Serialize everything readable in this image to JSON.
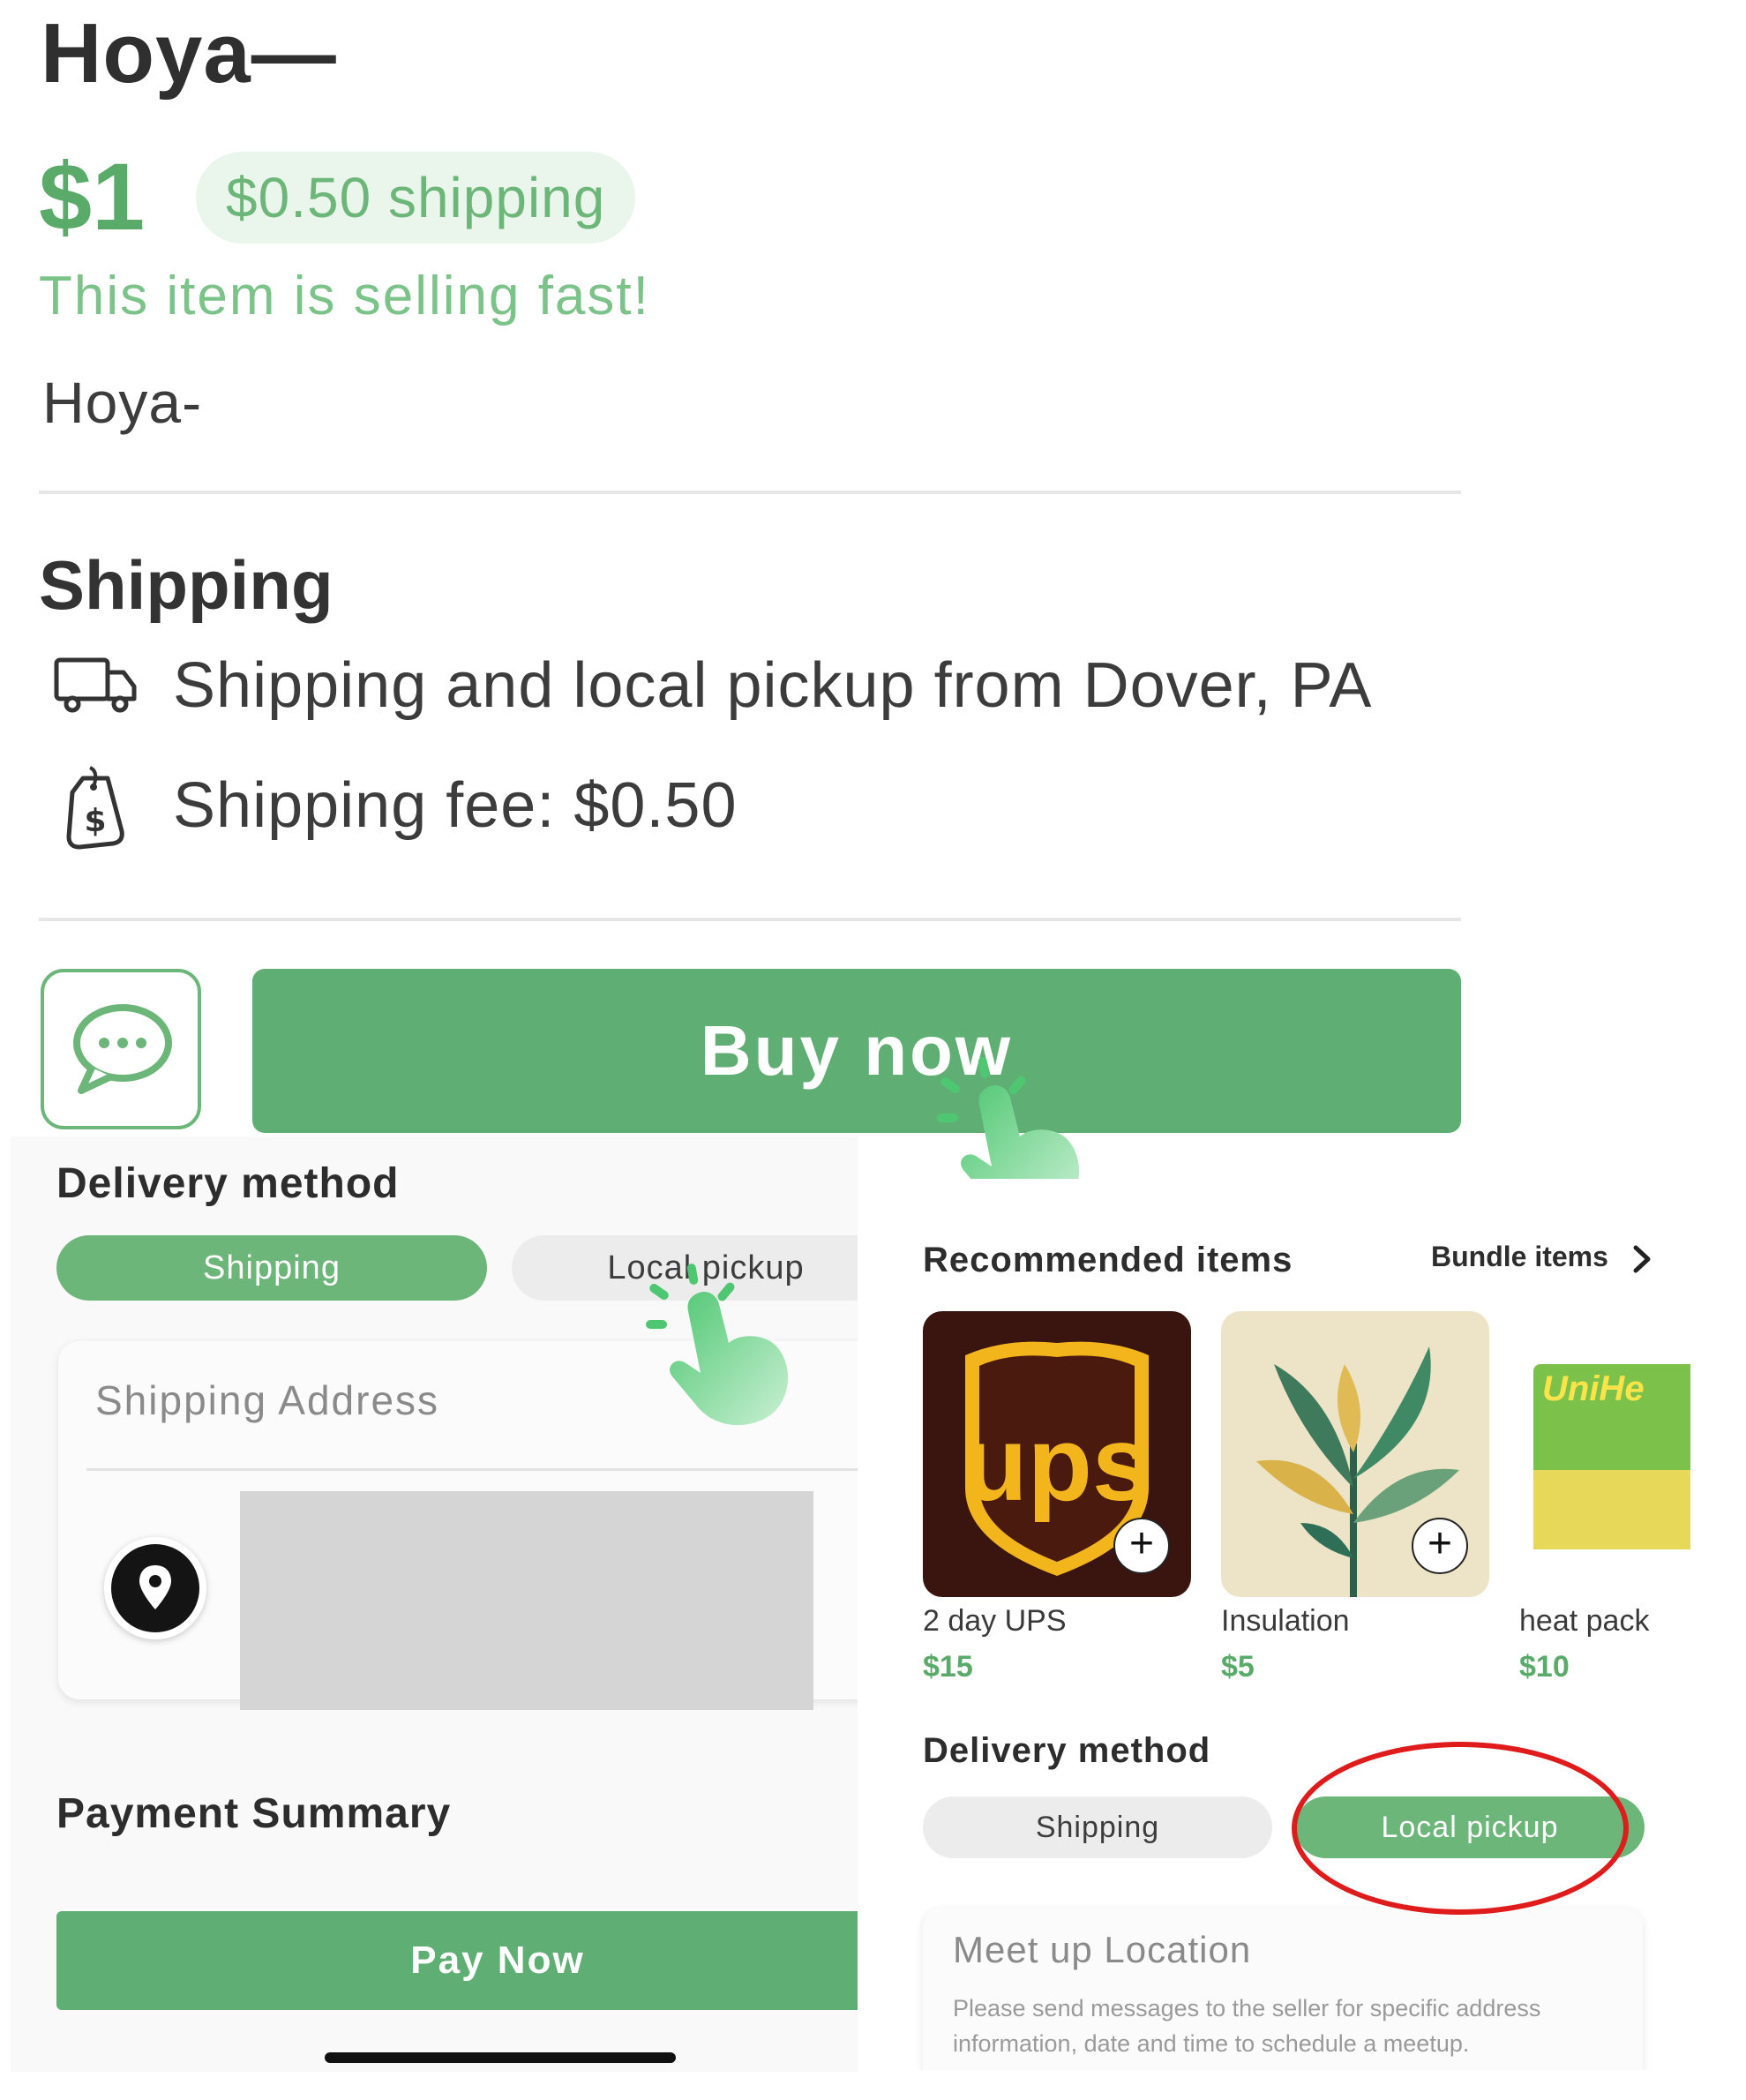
{
  "listing": {
    "title": "Hoya—",
    "price": "$1",
    "shipping_badge": "$0.50 shipping",
    "urgency": "This item is selling fast!",
    "subtitle": "Hoya-"
  },
  "shipping_section": {
    "heading": "Shipping",
    "origin": "Shipping and local pickup from Dover, PA",
    "fee": "Shipping fee: $0.50"
  },
  "actions": {
    "buy_label": "Buy now"
  },
  "left_sheet": {
    "delivery_heading": "Delivery method",
    "toggle_shipping": "Shipping",
    "toggle_pickup": "Local pickup",
    "selected": "Shipping",
    "address_placeholder": "Shipping Address",
    "payment_heading": "Payment Summary",
    "pay_label": "Pay Now"
  },
  "right_sheet": {
    "recommended_heading": "Recommended items",
    "bundle_link": "Bundle items",
    "items": [
      {
        "name": "2 day UPS",
        "price": "$15"
      },
      {
        "name": "Insulation",
        "price": "$5"
      },
      {
        "name": "heat pack",
        "price": "$10"
      }
    ],
    "heat_pack_brand": "UniHe",
    "delivery_heading": "Delivery method",
    "toggle_shipping": "Shipping",
    "toggle_pickup": "Local pickup",
    "selected": "Local pickup",
    "meetup_title": "Meet up Location",
    "meetup_note": "Please send messages to the seller for specific address information, date and time to schedule a meetup."
  },
  "colors": {
    "accent": "#6db679",
    "button": "#5fae74",
    "highlight_ring": "#e01b1b"
  },
  "icons": [
    "truck-icon",
    "price-tag-icon",
    "chat-icon",
    "location-pin-icon",
    "chevron-right-icon",
    "plus-icon",
    "tap-hand-icon"
  ]
}
